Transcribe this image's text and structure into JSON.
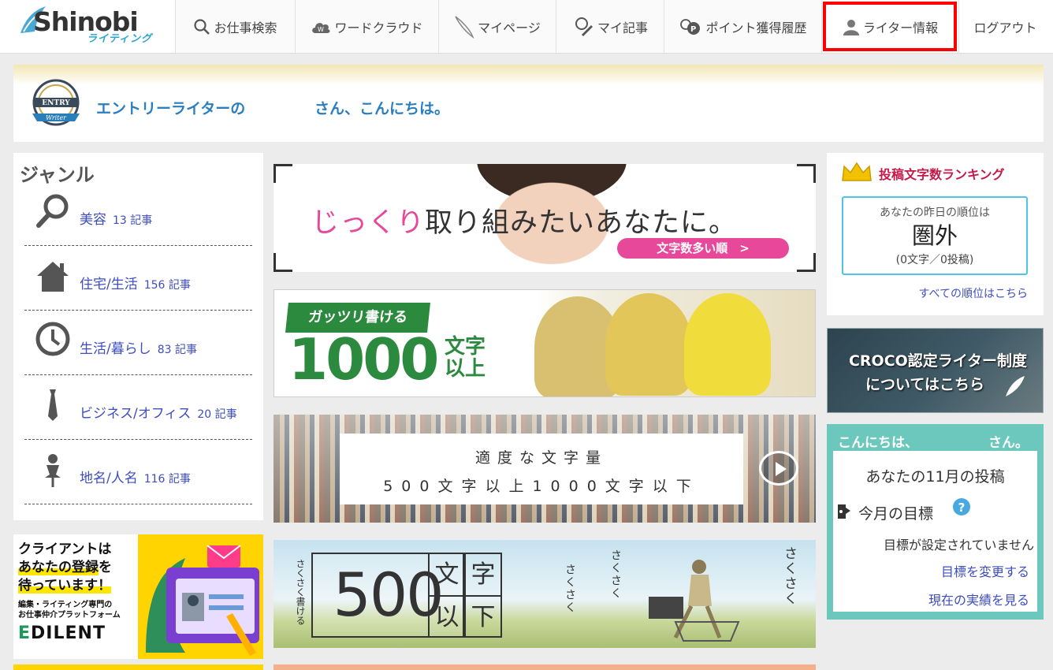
{
  "header": {
    "logo_text": "Shinobi",
    "logo_sub": "ライティング",
    "nav": [
      {
        "label": "お仕事検索",
        "icon": "search-icon"
      },
      {
        "label": "ワードクラウド",
        "icon": "cloud-icon"
      },
      {
        "label": "マイページ",
        "icon": "quill-icon"
      },
      {
        "label": "マイ記事",
        "icon": "article-icon"
      },
      {
        "label": "ポイント獲得履歴",
        "icon": "points-icon"
      },
      {
        "label": "ライター情報",
        "icon": "user-icon",
        "highlighted": true
      },
      {
        "label": "ログアウト"
      }
    ]
  },
  "welcome": {
    "badge_top": "ENTRY",
    "badge_bottom": "Writer",
    "greeting_prefix": "エントリーライターの",
    "greeting_suffix": "さん、こんにちは。"
  },
  "genre": {
    "title": "ジャンル",
    "items": [
      {
        "label": "美容",
        "count": "13 記事",
        "icon": "magnifier-icon"
      },
      {
        "label": "住宅/生活",
        "count": "156 記事",
        "icon": "house-icon"
      },
      {
        "label": "生活/暮らし",
        "count": "83 記事",
        "icon": "clock-icon"
      },
      {
        "label": "ビジネス/オフィス",
        "count": "20 記事",
        "icon": "necktie-icon"
      },
      {
        "label": "地名/人名",
        "count": "116 記事",
        "icon": "pin-icon"
      }
    ]
  },
  "edilent_ad": {
    "line1a": "クライアントは",
    "line1b": "あなたの登録",
    "line1c": "を",
    "line1d": "待っています！",
    "line2a": "編集・ライティング専門の",
    "line2b": "お仕事仲介プラットフォーム",
    "brand_mark": "E",
    "brand": "DILENT"
  },
  "banners": {
    "b1": {
      "text_pink": "じっくり",
      "text_rest": "取り組みたいあなたに。",
      "button": "文字数多い順　>"
    },
    "b2": {
      "tag": "ガッツリ書ける",
      "big": "1000",
      "small": "文字以上"
    },
    "b3": {
      "line1": "適度な文字量",
      "line2": "500文字以上1000文字以下"
    },
    "b4": {
      "side": "さくさく書ける",
      "big": "500",
      "grid": [
        "文",
        "字",
        "以",
        "下"
      ],
      "saku": "さくさく"
    }
  },
  "ranking": {
    "title": "投稿文字数ランキング",
    "label": "あなたの昨日の順位は",
    "rank": "圏外",
    "detail": "(0文字／0投稿)",
    "more": "すべての順位はこちら"
  },
  "croco": {
    "line1": "CROCO認定ライター制度",
    "line2": "についてはこちら"
  },
  "hello": {
    "greet1": "こんにちは、",
    "greet2": "さん。",
    "posts": "あなたの11月の投稿",
    "goal_label": "今月の目標",
    "no_goal": "目標が設定されていません",
    "change_goal": "目標を変更する",
    "see_results": "現在の実績を見る"
  },
  "colors": {
    "link": "#3e4dc0",
    "greeting": "#2b7fc0",
    "highlight_border": "#ff0000",
    "teal": "#6cc7bd",
    "rank_title": "#c41a4a"
  }
}
